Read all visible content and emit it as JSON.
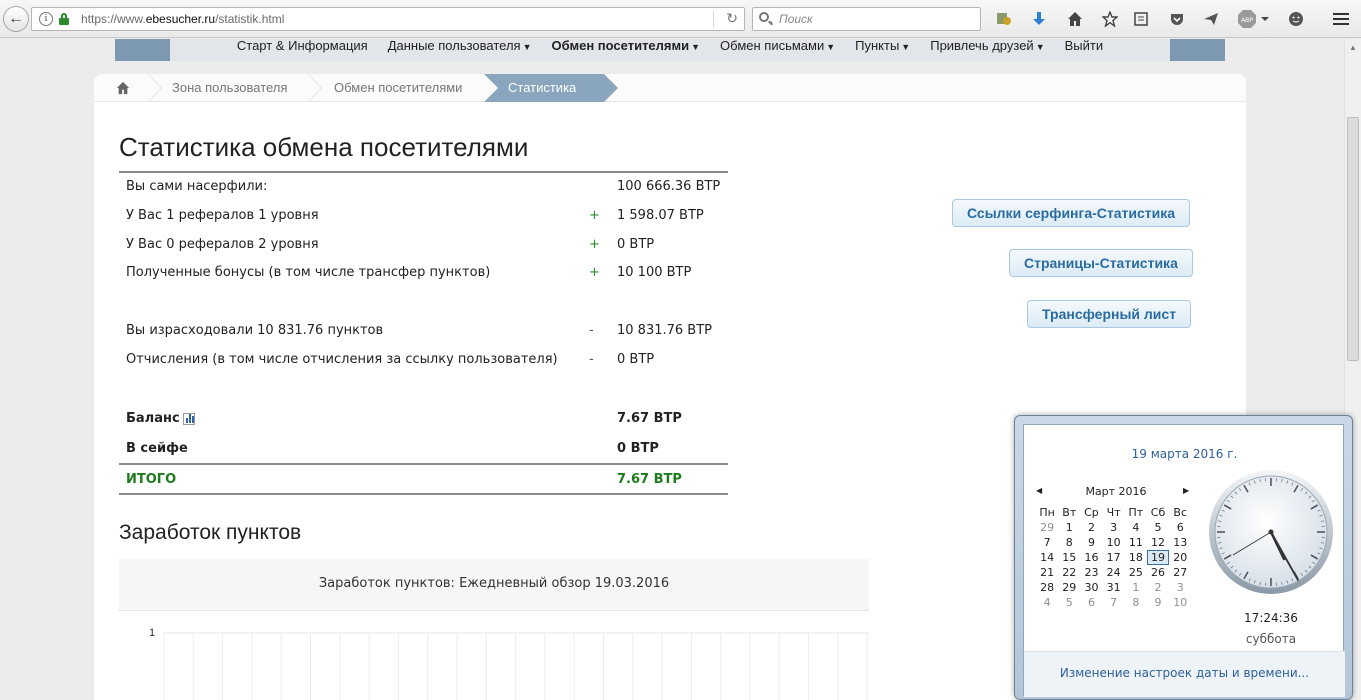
{
  "browser": {
    "url_prefix": "https://www.",
    "url_domain": "ebesucher.ru",
    "url_path": "/statistik.html",
    "search_placeholder": "Поиск",
    "abp_label": "ABP"
  },
  "nav": {
    "items": [
      {
        "label": "Старт & Информация",
        "dropdown": false,
        "active": false
      },
      {
        "label": "Данные пользователя",
        "dropdown": true,
        "active": false
      },
      {
        "label": "Обмен посетителями",
        "dropdown": true,
        "active": true
      },
      {
        "label": "Обмен письмами",
        "dropdown": true,
        "active": false
      },
      {
        "label": "Пункты",
        "dropdown": true,
        "active": false
      },
      {
        "label": "Привлечь друзей",
        "dropdown": true,
        "active": false
      },
      {
        "label": "Выйти",
        "dropdown": false,
        "active": false
      }
    ]
  },
  "breadcrumb": {
    "home_icon": "home-icon",
    "items": [
      "Зона пользователя",
      "Обмен посетителями",
      "Статистика"
    ]
  },
  "page_title": "Статистика обмена посетителями",
  "stats": {
    "rows": [
      {
        "label": "Вы сами насерфили:",
        "sign": "",
        "value": "100 666.36 BTP"
      },
      {
        "label": "У Вас 1 рефералов 1 уровня",
        "sign": "+",
        "value": "1 598.07 BTP"
      },
      {
        "label": "У Вас 0 рефералов 2 уровня",
        "sign": "+",
        "value": "0 BTP"
      },
      {
        "label": "Полученные бонусы (в том числе трансфер пунктов)",
        "sign": "+",
        "value": "10 100 BTP"
      },
      {
        "label": "Вы израсходовали 10 831.76 пунктов",
        "sign": "-",
        "value": "10 831.76 BTP"
      },
      {
        "label": "Отчисления (в том числе отчисления за ссылку пользователя)",
        "sign": "-",
        "value": "0 BTP"
      }
    ],
    "balance_label": "Баланс",
    "balance_value": "7.67 BTP",
    "safe_label": "В сейфе",
    "safe_value": "0 BTP",
    "total_label": "ИТОГО",
    "total_value": "7.67 BTP"
  },
  "buttons": {
    "surf_links": "Ссылки серфинга-Статистика",
    "pages": "Страницы-Статистика",
    "transfer": "Трансферный лист"
  },
  "earnings": {
    "section_title": "Заработок пунктов",
    "chart_title": "Заработок пунктов: Ежедневный обзор 19.03.2016",
    "y_tick": "1"
  },
  "clock": {
    "date_long": "19 марта 2016 г.",
    "month_label": "Март 2016",
    "weekdays": [
      "Пн",
      "Вт",
      "Ср",
      "Чт",
      "Пт",
      "Сб",
      "Вс"
    ],
    "days": [
      [
        "29",
        "1",
        "2",
        "3",
        "4",
        "5",
        "6"
      ],
      [
        "7",
        "8",
        "9",
        "10",
        "11",
        "12",
        "13"
      ],
      [
        "14",
        "15",
        "16",
        "17",
        "18",
        "19",
        "20"
      ],
      [
        "21",
        "22",
        "23",
        "24",
        "25",
        "26",
        "27"
      ],
      [
        "28",
        "29",
        "30",
        "31",
        "1",
        "2",
        "3"
      ],
      [
        "4",
        "5",
        "6",
        "7",
        "8",
        "9",
        "10"
      ]
    ],
    "today": "19",
    "time": "17:24:36",
    "weekday_name": "суббота",
    "settings_link": "Изменение настроек даты и времени..."
  }
}
